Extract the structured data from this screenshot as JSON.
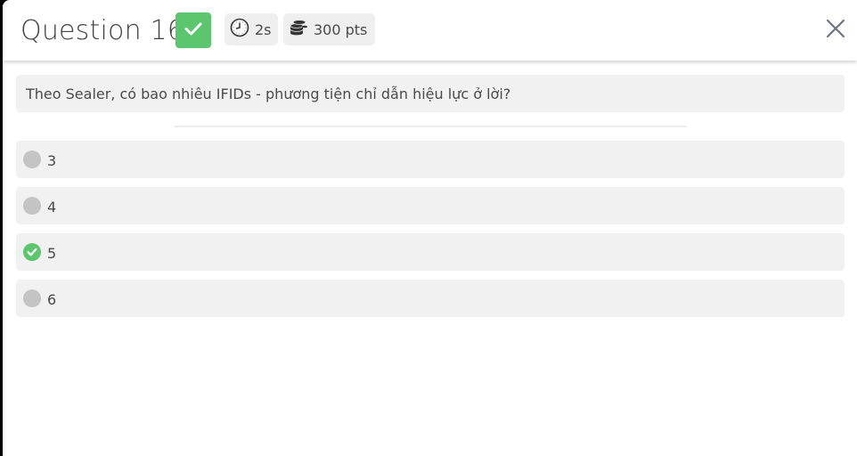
{
  "header": {
    "title": "Question 16",
    "status_icon": "check-icon",
    "time_label": "2s",
    "time_icon": "clock-icon",
    "points_label": "300 pts",
    "points_icon": "coins-icon",
    "close_icon": "close-icon"
  },
  "question": {
    "text": "Theo Sealer, có bao nhiêu IFIDs - phương tiện chỉ dẫn hiệu lực ở lời?"
  },
  "options": [
    {
      "label": "3",
      "selected": false
    },
    {
      "label": "4",
      "selected": false
    },
    {
      "label": "5",
      "selected": true
    },
    {
      "label": "6",
      "selected": false
    }
  ],
  "colors": {
    "correct": "#5bc66d",
    "radio_unselected": "#c4c4c4",
    "panel": "#f1f1f1"
  }
}
